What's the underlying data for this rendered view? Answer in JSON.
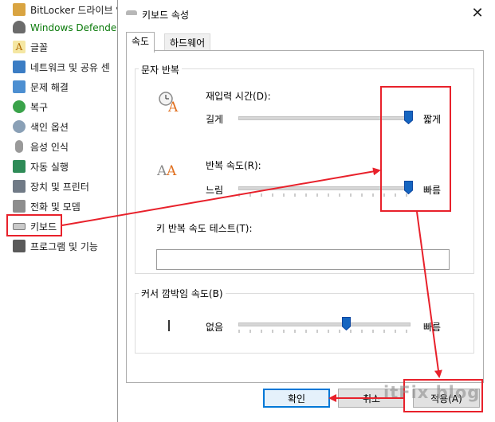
{
  "control_panel": {
    "items": [
      {
        "label": "BitLocker 드라이브 암",
        "icon": "bitlocker-icon",
        "color": "#1a1a1a"
      },
      {
        "label": "Windows Defender 방",
        "icon": "defender-icon",
        "color": "#0a7a0a"
      },
      {
        "label": "글꼴",
        "icon": "font-icon",
        "color": "#1a1a1a"
      },
      {
        "label": "네트워크 및 공유 센",
        "icon": "network-icon",
        "color": "#1a1a1a"
      },
      {
        "label": "문제 해결",
        "icon": "troubleshoot-icon",
        "color": "#1a1a1a"
      },
      {
        "label": "복구",
        "icon": "recovery-icon",
        "color": "#1a1a1a"
      },
      {
        "label": "색인 옵션",
        "icon": "index-icon",
        "color": "#1a1a1a"
      },
      {
        "label": "음성 인식",
        "icon": "microphone-icon",
        "color": "#1a1a1a"
      },
      {
        "label": "자동 실행",
        "icon": "autoplay-icon",
        "color": "#1a1a1a"
      },
      {
        "label": "장치 및 프린터",
        "icon": "printer-icon",
        "color": "#1a1a1a"
      },
      {
        "label": "전화 및 모뎀",
        "icon": "phone-icon",
        "color": "#1a1a1a"
      },
      {
        "label": "키보드",
        "icon": "keyboard-icon",
        "color": "#1a1a1a"
      },
      {
        "label": "프로그램 및 기능",
        "icon": "programs-icon",
        "color": "#1a1a1a"
      }
    ]
  },
  "dialog": {
    "title": "키보드 속성",
    "close": "✕",
    "tabs": [
      "속도",
      "하드웨어"
    ],
    "active_tab": "속도",
    "repeat_group": {
      "title": "문자 반복",
      "delay": {
        "label": "재입력 시간(D):",
        "min_label": "길게",
        "max_label": "짧게",
        "level": 1.0
      },
      "rate": {
        "label": "반복 속도(R):",
        "min_label": "느림",
        "max_label": "빠름",
        "level": 1.0
      },
      "test_label": "키 반복 속도 테스트(T):",
      "test_value": ""
    },
    "cursor_group": {
      "title": "커서 깜박임 속도(B)",
      "min_label": "없음",
      "max_label": "빠름",
      "level": 0.625
    },
    "buttons": {
      "ok": "확인",
      "cancel": "취소",
      "apply": "적용(A)"
    }
  },
  "watermark": "itFix blog",
  "colors": {
    "highlight": "#e8212b",
    "accent": "#0078d7",
    "slider_thumb": "#1565c0"
  }
}
